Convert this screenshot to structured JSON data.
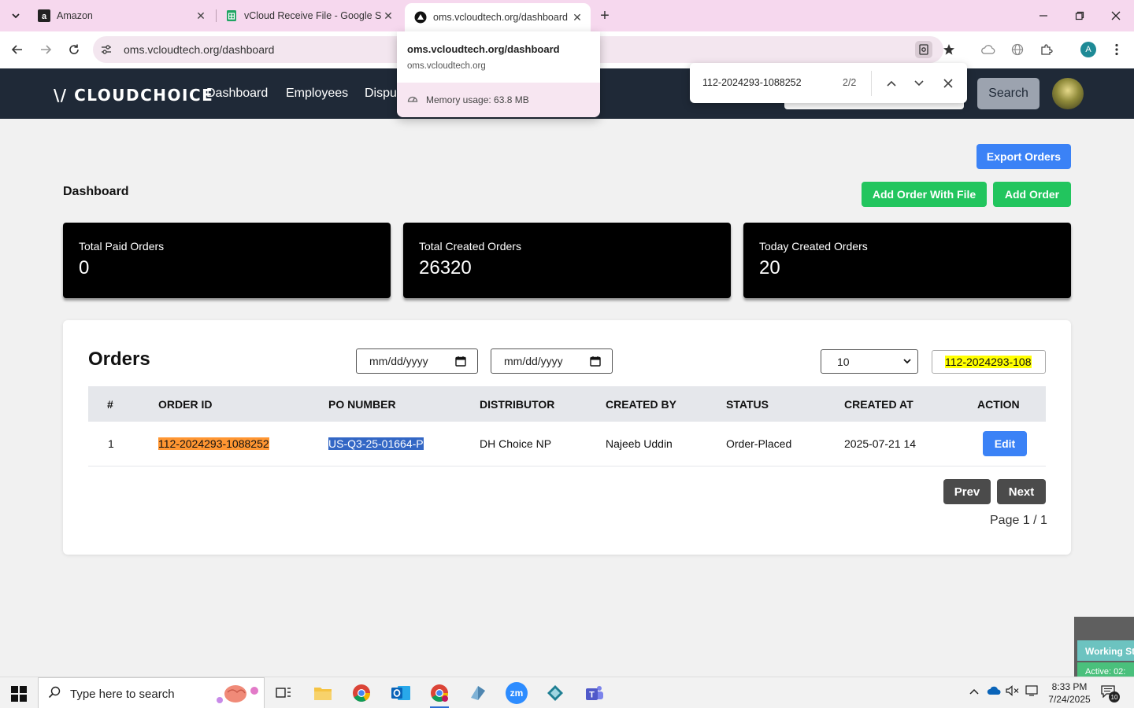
{
  "browser": {
    "tabs": [
      {
        "title": "Amazon",
        "favicon": "amazon-icon"
      },
      {
        "title": "vCloud Receive File - Google Sh",
        "favicon": "google-sheets-icon"
      },
      {
        "title": "oms.vcloudtech.org/dashboard",
        "favicon": "site-icon",
        "active": true
      }
    ],
    "url": "oms.vcloudtech.org/dashboard",
    "hover_card": {
      "title": "oms.vcloudtech.org/dashboard",
      "domain": "oms.vcloudtech.org",
      "memory": "Memory usage: 63.8 MB"
    },
    "find_bar": {
      "query": "112-2024293-1088252",
      "count": "2/2"
    },
    "profile_initial": "A"
  },
  "app": {
    "logo": "\\/ CLOUDCHOICE",
    "nav": [
      {
        "label": "Dashboard"
      },
      {
        "label": "Employees"
      },
      {
        "label": "Dispu"
      }
    ],
    "search_button": "Search"
  },
  "dashboard": {
    "title": "Dashboard",
    "export_button": "Export Orders",
    "add_with_file_button": "Add Order With File",
    "add_order_button": "Add Order",
    "stats": [
      {
        "label": "Total Paid Orders",
        "value": "0"
      },
      {
        "label": "Total Created Orders",
        "value": "26320"
      },
      {
        "label": "Today Created Orders",
        "value": "20"
      }
    ]
  },
  "orders": {
    "title": "Orders",
    "date_from_placeholder": "mm/dd/yyyy",
    "date_to_placeholder": "mm/dd/yyyy",
    "page_size": "10",
    "search_value": "112-2024293-108",
    "columns": [
      "#",
      "ORDER ID",
      "PO NUMBER",
      "DISTRIBUTOR",
      "CREATED BY",
      "STATUS",
      "CREATED AT",
      "ACTION"
    ],
    "rows": [
      {
        "index": "1",
        "order_id": "112-2024293-1088252",
        "po_number": "US-Q3-25-01664-P",
        "distributor": "DH Choice NP",
        "created_by": "Najeeb Uddin",
        "status": "Order-Placed",
        "created_at": "2025-07-21 14",
        "action": "Edit"
      }
    ],
    "prev_button": "Prev",
    "next_button": "Next",
    "page_info": "Page 1 / 1"
  },
  "widget": {
    "working": "Working St",
    "active": "Active: 02:"
  },
  "taskbar": {
    "search_placeholder": "Type here to search",
    "time": "8:33 PM",
    "date": "7/24/2025",
    "notification_count": "10"
  },
  "colors": {
    "tabbar": "#f6d8ee",
    "app_header": "#1f2937",
    "primary_blue": "#3b82f6",
    "success_green": "#22c55e",
    "find_highlight_orange": "#ff9632",
    "find_highlight_yellow": "#ffff00",
    "selection_blue": "#3367c5"
  }
}
